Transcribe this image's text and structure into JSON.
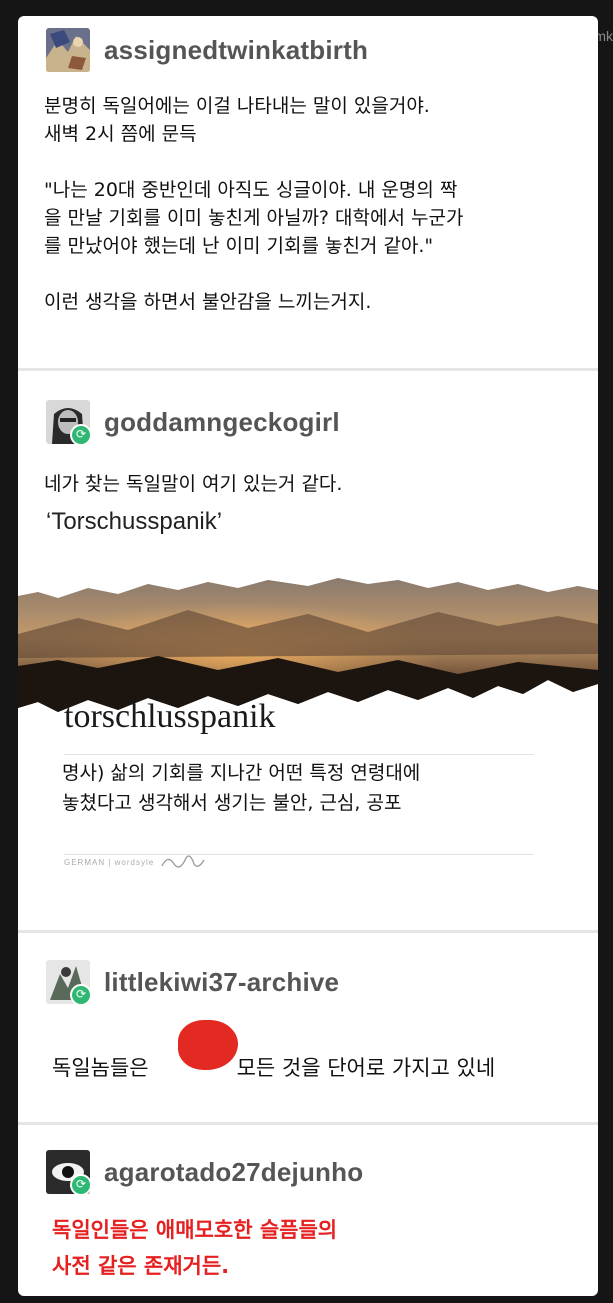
{
  "watermark": "mk",
  "posts": [
    {
      "username": "assignedtwinkatbirth",
      "text": "분명히 독일어에는 이걸 나타내는 말이 있을거야.\n새벽 2시 쯤에 문득\n\n\"나는 20대 중반인데 아직도 싱글이야. 내 운명의 짝\n을 만날 기회를 이미 놓친게 아닐까? 대학에서 누군가\n를 만났어야 했는데 난 이미 기회를 놓친거 같아.\"\n\n이런 생각을 하면서 불안감을 느끼는거지."
    },
    {
      "username": "goddamngeckogirl",
      "text": "네가 찾는 독일말이 여기 있는거 같다.",
      "quote": "‘Torschusspanik’",
      "dictionary": {
        "word": "torschlusspanik",
        "definition": "명사) 삶의 기회를 지나간 어떤 특정 연령대에\n놓쳤다고 생각해서 생기는 불안, 근심, 공포",
        "footer": "GERMAN | wordsyle"
      }
    },
    {
      "username": "littlekiwi37-archive",
      "text_before": "독일놈들은",
      "text_after": "모든 것을 단어로 가지고 있네"
    },
    {
      "username": "agarotado27dejunho",
      "text": "독일인들은 애매모호한 슬픔들의\n사전 같은 존재거든.",
      "text_color": "#e62020"
    }
  ],
  "reblog_icon": "reblog-icon",
  "accent": "#2fb873"
}
